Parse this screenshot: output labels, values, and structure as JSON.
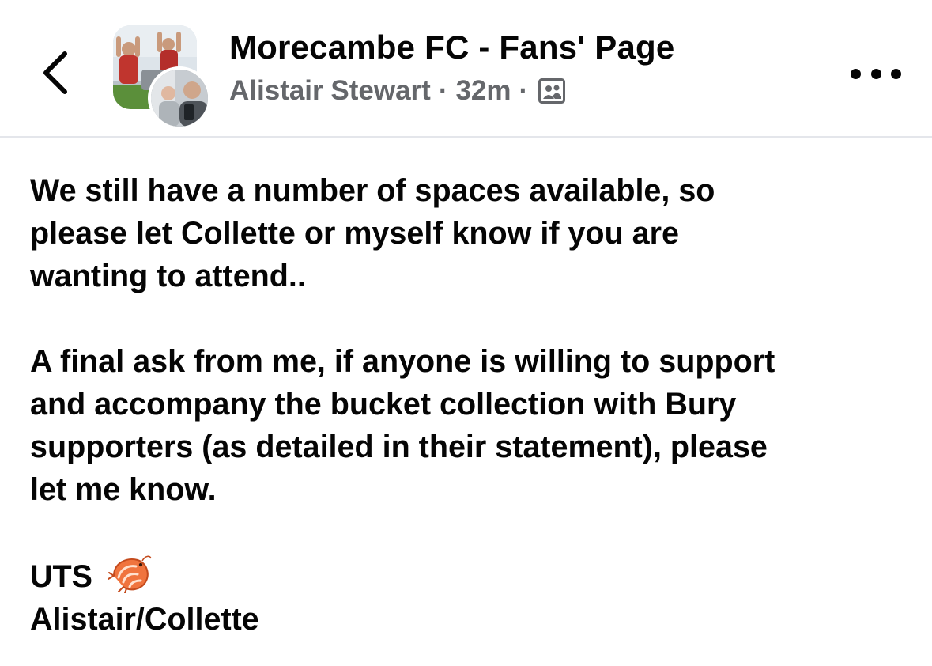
{
  "header": {
    "back_icon": "chevron-left-icon",
    "group_title": "Morecambe FC - Fans' Page",
    "author": "Alistair Stewart",
    "separator": "·",
    "time": "32m",
    "privacy_icon": "group-members-icon",
    "more_icon": "more-horizontal-icon"
  },
  "post": {
    "paragraph1": [
      "We still have a number of spaces available, so",
      "please let Collette or myself know if you are",
      "wanting to attend.."
    ],
    "paragraph2": [
      "A final ask from me, if anyone is willing to support",
      "and accompany the bucket collection with Bury",
      "supporters (as detailed in their statement), please",
      "let me know."
    ],
    "signoff": "UTS",
    "signoff_emoji": "shrimp-emoji",
    "signature": "Alistair/Collette"
  },
  "colors": {
    "text_primary": "#050505",
    "text_secondary": "#65676b",
    "divider": "#e4e6eb",
    "background": "#ffffff",
    "emoji_orange": "#f0743e"
  }
}
